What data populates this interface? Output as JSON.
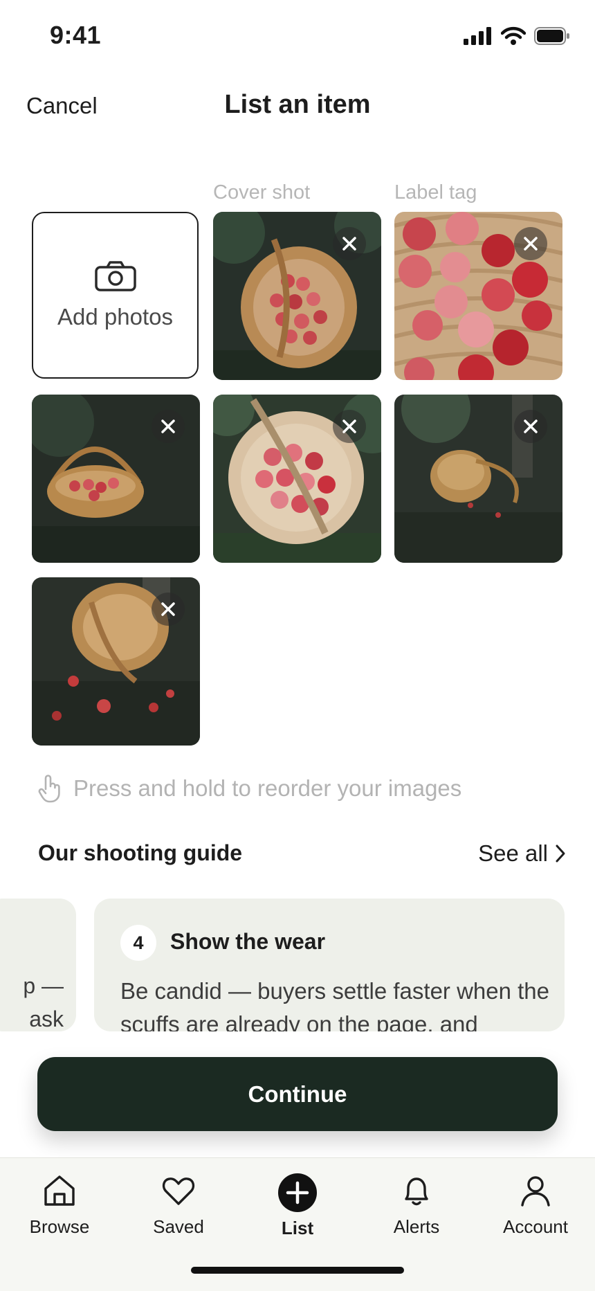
{
  "status": {
    "time": "9:41"
  },
  "header": {
    "cancel_label": "Cancel",
    "title": "List an item"
  },
  "photos": {
    "add_label": "Add photos",
    "labels": {
      "cover": "Cover shot",
      "tag": "Label tag"
    }
  },
  "reorder_hint": "Press and hold to reorder your images",
  "guide": {
    "title": "Our shooting guide",
    "see_all": "See all",
    "prev_card_line1": "p —",
    "prev_card_line2": "ask",
    "card": {
      "step": "4",
      "title": "Show the wear",
      "body": "Be candid — buyers settle faster when the scuffs are already on the page, and"
    }
  },
  "cta": {
    "continue_label": "Continue"
  },
  "tabs": [
    {
      "label": "Browse"
    },
    {
      "label": "Saved"
    },
    {
      "label": "List"
    },
    {
      "label": "Alerts"
    },
    {
      "label": "Account"
    }
  ],
  "colors": {
    "primary": "#1b2a22",
    "card_bg": "#eef0ea",
    "muted": "#b3b3b3"
  }
}
